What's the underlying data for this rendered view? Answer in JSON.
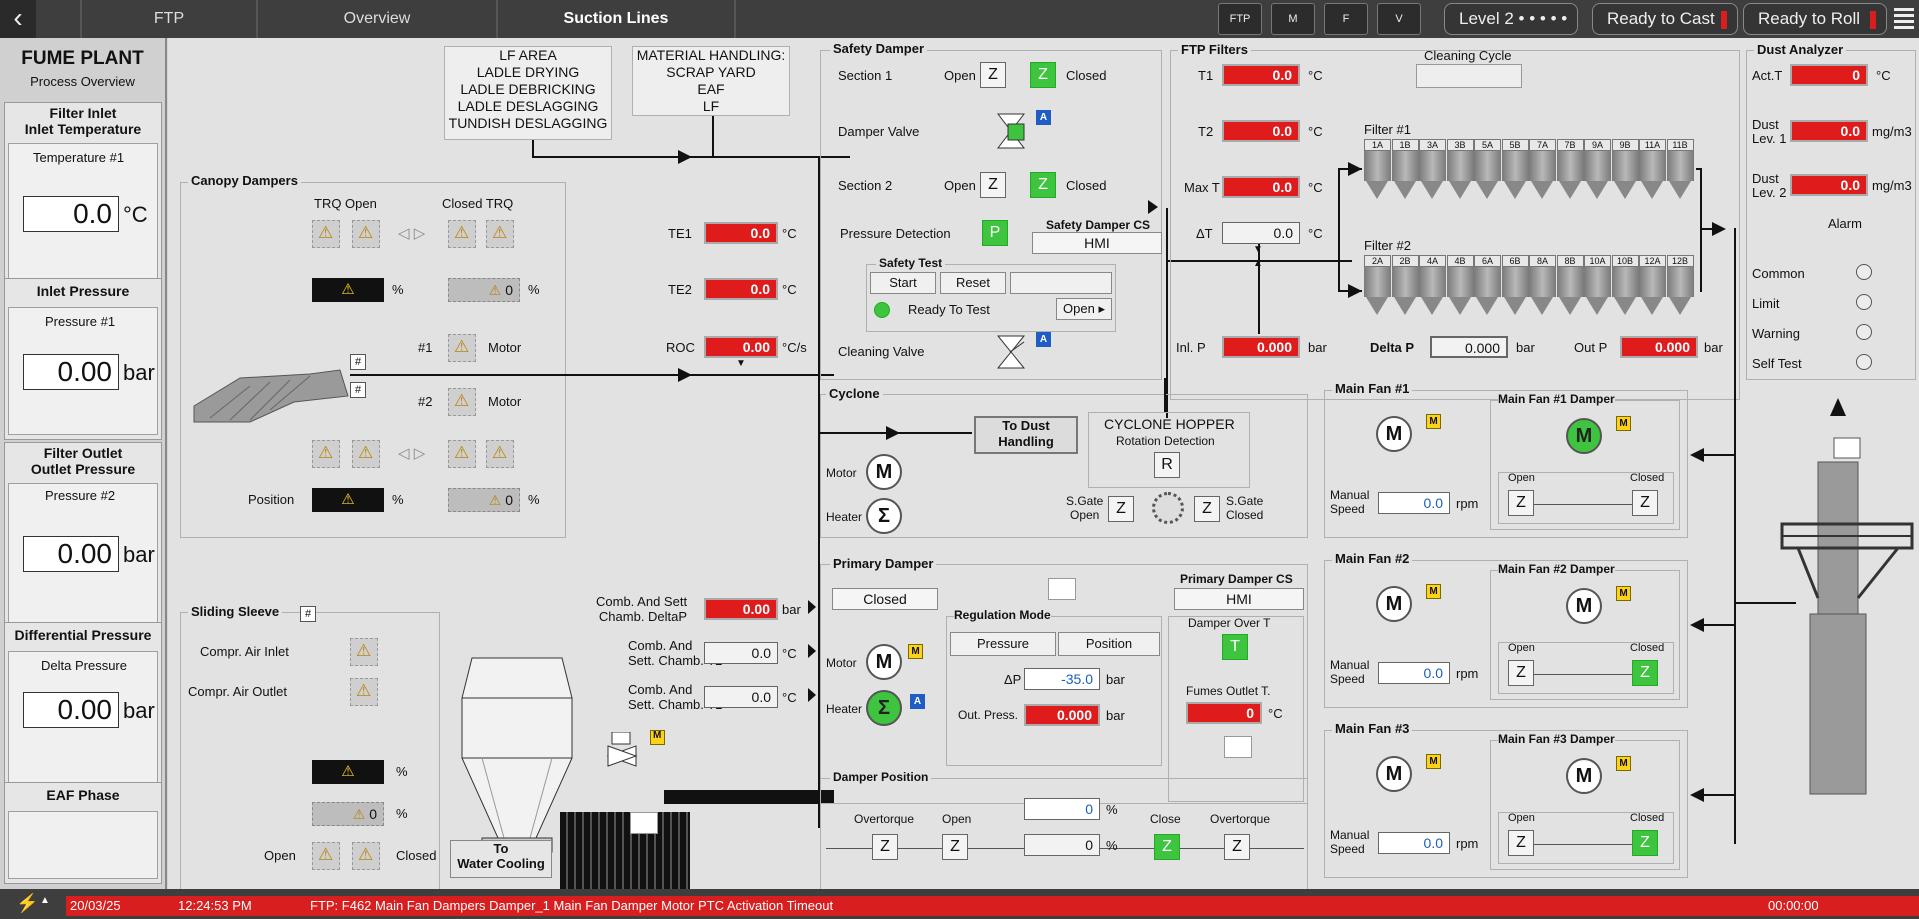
{
  "header": {
    "breadcrumbs": [
      "FTP",
      "Overview",
      "Suction Lines"
    ],
    "toolbar_icons": [
      "FTP",
      "M",
      "F",
      "V"
    ],
    "level": "Level 2 • • • • • •",
    "ready_cast": "Ready to Cast",
    "ready_roll": "Ready to Roll"
  },
  "left_panel": {
    "title": "FUME PLANT",
    "subtitle": "Process Overview",
    "filter_inlet": "Filter Inlet",
    "inlet_temperature": "Inlet Temperature",
    "temp1_label": "Temperature #1",
    "temp1_value": "0.0",
    "temp1_unit": "°C",
    "inlet_pressure": "Inlet Pressure",
    "pressure1_label": "Pressure #1",
    "pressure1_value": "0.00",
    "pressure1_unit": "bar",
    "filter_outlet": "Filter Outlet",
    "outlet_pressure": "Outlet Pressure",
    "pressure2_label": "Pressure #2",
    "pressure2_value": "0.00",
    "pressure2_unit": "bar",
    "diff_pressure": "Differential Pressure",
    "delta_label": "Delta Pressure",
    "delta_value": "0.00",
    "delta_unit": "bar",
    "eaf_phase": "EAF Phase"
  },
  "sources": {
    "lf_area": [
      "LF AREA",
      "LADLE DRYING",
      "LADLE DEBRICKING",
      "LADLE DESLAGGING",
      "TUNDISH DESLAGGING"
    ],
    "material": [
      "MATERIAL HANDLING:",
      "SCRAP YARD",
      "EAF",
      "LF"
    ]
  },
  "canopy": {
    "title": "Canopy Dampers",
    "trq_open": "TRQ Open",
    "closed_trq": "Closed TRQ",
    "pct": "%",
    "zero": "0",
    "m1": "#1",
    "m2": "#2",
    "motor": "Motor",
    "position": "Position",
    "hash": "#"
  },
  "temps": {
    "te1": "TE1",
    "te1_val": "0.0",
    "te2": "TE2",
    "te2_val": "0.0",
    "roc": "ROC",
    "roc_val": "0.00",
    "degc": "°C",
    "degcs": "°C/s"
  },
  "sliding": {
    "title": "Sliding Sleeve",
    "air_inlet": "Compr. Air Inlet",
    "air_outlet": "Compr. Air Outlet",
    "open": "Open",
    "closed": "Closed",
    "to_water_1": "To",
    "to_water_2": "Water Cooling"
  },
  "chamber": {
    "deltap_1": "Comb. And Sett",
    "deltap_2": "Chamb. DeltaP",
    "deltap_val": "0.00",
    "bar": "bar",
    "t2_1": "Comb. And",
    "t2_2": "Sett. Chamb. T2",
    "t2_val": "0.0",
    "t1_1": "Comb. And",
    "t1_2": "Sett. Chamb. T1",
    "t1_val": "0.0"
  },
  "safety": {
    "title": "Safety Damper",
    "section1": "Section 1",
    "section2": "Section 2",
    "open": "Open",
    "closed": "Closed",
    "damper_valve": "Damper Valve",
    "pressure_detection": "Pressure Detection",
    "cs_title": "Safety Damper CS",
    "cs_value": "HMI",
    "test_title": "Safety Test",
    "start": "Start",
    "reset": "Reset",
    "ready": "Ready To Test",
    "open_btn": "Open",
    "cleaning_valve": "Cleaning Valve",
    "z": "Z",
    "p": "P",
    "a": "A"
  },
  "cyclone": {
    "title": "Cyclone",
    "to_dust_1": "To Dust",
    "to_dust_2": "Handling",
    "hopper": "CYCLONE HOPPER",
    "rotation": "Rotation Detection",
    "r": "R",
    "motor": "Motor",
    "heater": "Heater",
    "sgate_open_1": "S.Gate",
    "sgate_open_2": "Open",
    "sgate_closed_1": "S.Gate",
    "sgate_closed_2": "Closed"
  },
  "primary": {
    "title": "Primary Damper",
    "state": "Closed",
    "cs_title": "Primary Damper CS",
    "cs_value": "HMI",
    "reg_mode": "Regulation Mode",
    "pressure_btn": "Pressure",
    "position_btn": "Position",
    "dp_label": "ΔP",
    "dp_val": "-35.0",
    "out_press": "Out. Press.",
    "out_val": "0.000",
    "bar": "bar",
    "over_t": "Damper Over T",
    "t": "T",
    "fumes_outlet": "Fumes Outlet T.",
    "fumes_val": "0",
    "degc": "°C",
    "motor": "Motor",
    "heater": "Heater"
  },
  "damper_position": {
    "title": "Damper Position",
    "overtorque": "Overtorque",
    "open": "Open",
    "close": "Close",
    "setpoint": "0",
    "actual": "0",
    "pct": "%"
  },
  "ftp": {
    "title": "FTP Filters",
    "cleaning_cycle": "Cleaning Cycle",
    "t1": "T1",
    "t1_val": "0.0",
    "t2": "T2",
    "t2_val": "0.0",
    "maxt": "Max T",
    "maxt_val": "0.0",
    "dt": "ΔT",
    "dt_val": "0.0",
    "degc": "°C",
    "filter1": "Filter #1",
    "filter2": "Filter #2",
    "filter1_cells": [
      "1A",
      "1B",
      "3A",
      "3B",
      "5A",
      "5B",
      "7A",
      "7B",
      "9A",
      "9B",
      "11A",
      "11B"
    ],
    "filter2_cells": [
      "2A",
      "2B",
      "4A",
      "4B",
      "6A",
      "6B",
      "8A",
      "8B",
      "10A",
      "10B",
      "12A",
      "12B"
    ],
    "inlp": "Inl. P",
    "inlp_val": "0.000",
    "deltap": "Delta P",
    "deltap_val": "0.000",
    "outp": "Out P",
    "outp_val": "0.000",
    "bar": "bar"
  },
  "dust": {
    "title": "Dust Analyzer",
    "actt": "Act.T",
    "actt_val": "0",
    "degc": "°C",
    "lev1_1": "Dust",
    "lev1_2": "Lev. 1",
    "lev1_val": "0.0",
    "lev2_1": "Dust",
    "lev2_2": "Lev. 2",
    "lev2_val": "0.0",
    "unit": "mg/m3",
    "alarm": "Alarm",
    "common": "Common",
    "limit": "Limit",
    "warning": "Warning",
    "self_test": "Self Test"
  },
  "fans": [
    {
      "title": "Main Fan #1",
      "damper": "Main Fan #1 Damper",
      "speed": "0.0"
    },
    {
      "title": "Main Fan #2",
      "damper": "Main Fan #2 Damper",
      "speed": "0.0"
    },
    {
      "title": "Main Fan #3",
      "damper": "Main Fan #3 Damper",
      "speed": "0.0"
    }
  ],
  "fan_common": {
    "manual": "Manual",
    "speed": "Speed",
    "rpm": "rpm",
    "open": "Open",
    "closed": "Closed",
    "m": "M",
    "z": "Z"
  },
  "alarm": {
    "date": "20/03/25",
    "time": "12:24:53 PM",
    "message": "FTP: F462 Main Fan Dampers Damper_1 Main Fan Damper Motor PTC Activation Timeout",
    "elapsed": "00:00:00"
  },
  "colors": {
    "alarm_red": "#d81e1e",
    "active_green": "#3ec43e",
    "manual_yellow": "#ffd21a",
    "auto_blue": "#1f5cc4"
  }
}
